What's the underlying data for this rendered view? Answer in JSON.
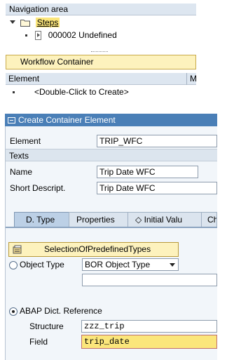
{
  "navigation": {
    "header": "Navigation area",
    "root_label": "Steps",
    "step_item": "000002 Undefined"
  },
  "workflow_container": {
    "label": "Workflow Container",
    "table_header": {
      "element_col": "Element",
      "second_col": "M"
    },
    "placeholder_row": "<Double-Click to Create>"
  },
  "dialog": {
    "title": "Create Container Element",
    "element_label": "Element",
    "element_value": "TRIP_WFC",
    "texts_section": "Texts",
    "name_label": "Name",
    "name_value": "Trip Date WFC",
    "short_desc_label": "Short Descript.",
    "short_desc_value": "Trip Date WFC",
    "tabs": [
      {
        "label": "D. Type",
        "active": true
      },
      {
        "label": "Properties",
        "active": false
      },
      {
        "label": "◇ Initial Valu",
        "active": false
      },
      {
        "label": "Ch",
        "active": false
      }
    ],
    "predefined_button": "SelectionOfPredefinedTypes",
    "object_type_radio": "Object Type",
    "object_type_value": "BOR Object Type",
    "abap_radio": "ABAP Dict. Reference",
    "structure_label": "Structure",
    "structure_value": "zzz_trip",
    "field_label": "Field",
    "field_value": "trip_date"
  },
  "colors": {
    "title_bar": "#4a7fb7",
    "highlight": "#fbe67b",
    "panel": "#f2f6fa"
  }
}
